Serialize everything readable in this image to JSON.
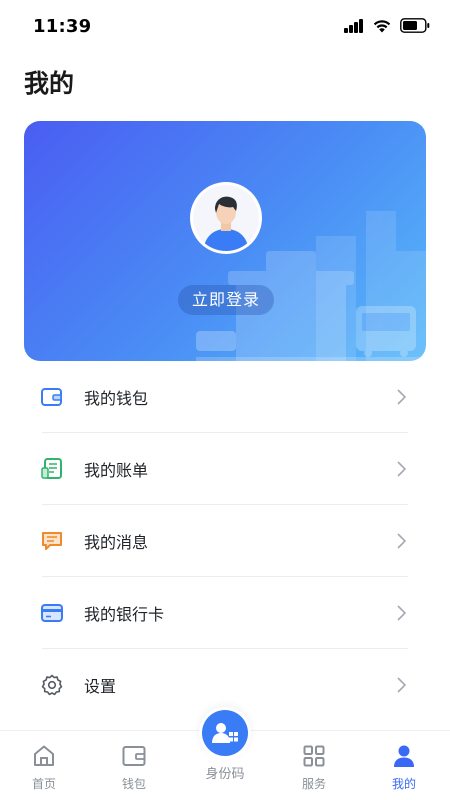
{
  "status_bar": {
    "time": "11:39"
  },
  "page": {
    "title": "我的"
  },
  "hero": {
    "login_label": "立即登录"
  },
  "menu": {
    "items": [
      {
        "label": "我的钱包",
        "icon": "wallet-icon",
        "color": "#3a7cf5"
      },
      {
        "label": "我的账单",
        "icon": "bill-icon",
        "color": "#32b36b"
      },
      {
        "label": "我的消息",
        "icon": "message-icon",
        "color": "#ee8a2b"
      },
      {
        "label": "我的银行卡",
        "icon": "bank-card-icon",
        "color": "#3a7cf5"
      },
      {
        "label": "设置",
        "icon": "gear-icon",
        "color": "#555a63"
      }
    ]
  },
  "tabbar": {
    "tabs": [
      {
        "label": "首页",
        "icon": "home-icon"
      },
      {
        "label": "钱包",
        "icon": "wallet-icon"
      },
      {
        "label": "身份码",
        "icon": "id-code-icon"
      },
      {
        "label": "服务",
        "icon": "grid-icon"
      },
      {
        "label": "我的",
        "icon": "user-icon",
        "active": true
      }
    ]
  },
  "colors": {
    "accent": "#3a7cf5",
    "inactive": "#8a8f98"
  }
}
